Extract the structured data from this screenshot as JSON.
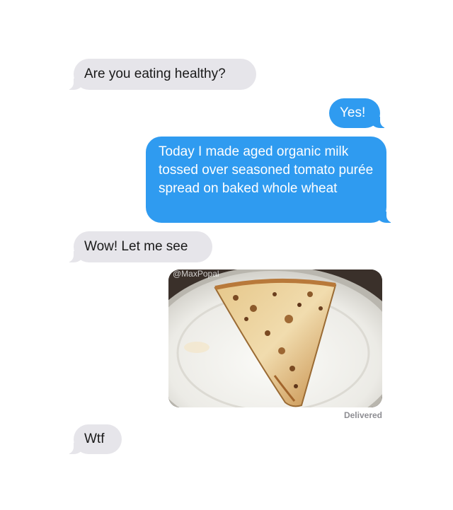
{
  "conversation": {
    "messages": [
      {
        "sender": "incoming",
        "text": "Are you eating healthy?"
      },
      {
        "sender": "outgoing",
        "text": "Yes!"
      },
      {
        "sender": "outgoing",
        "text": "Today I made aged organic milk tossed over seasoned tomato purée spread on baked whole wheat"
      },
      {
        "sender": "incoming",
        "text": "Wow! Let me see"
      },
      {
        "sender": "outgoing",
        "type": "image",
        "image": "pizza-slice-photo",
        "watermark": "@MaxPopal"
      },
      {
        "sender": "incoming",
        "text": "Wtf"
      }
    ],
    "status": "Delivered"
  },
  "colors": {
    "incoming_bubble": "#e6e5ea",
    "outgoing_bubble": "#2f9bf0",
    "status_text": "#8e8e93"
  }
}
